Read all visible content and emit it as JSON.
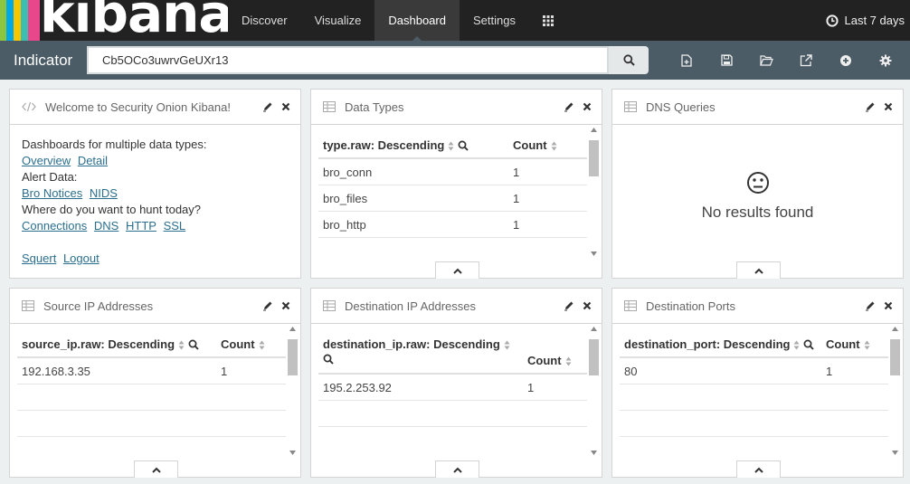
{
  "app": {
    "logo_text": "kibana",
    "brand_colors": [
      "#e8488b",
      "#3cbeb1",
      "#f6c700",
      "#8cc63f",
      "#00a9e5",
      "#ffffff"
    ]
  },
  "nav": {
    "items": [
      "Discover",
      "Visualize",
      "Dashboard",
      "Settings"
    ],
    "active": "Dashboard",
    "apps_icon": "grid-icon",
    "time_label": "Last 7 days"
  },
  "querybar": {
    "title": "Indicator",
    "query": "Cb5OCo3uwrvGeUXr13",
    "tools": [
      "new-dashboard-icon",
      "save-icon",
      "open-icon",
      "share-icon",
      "add-panel-icon",
      "options-icon"
    ]
  },
  "panels": {
    "welcome": {
      "title": "Welcome to Security Onion Kibana!",
      "line1": "Dashboards for multiple data types:",
      "links1": [
        "Overview",
        "Detail"
      ],
      "line2": "Alert Data:",
      "links2": [
        "Bro Notices",
        "NIDS"
      ],
      "line3": "Where do you want to hunt today?",
      "links3": [
        "Connections",
        "DNS",
        "HTTP",
        "SSL"
      ],
      "links4": [
        "Squert",
        "Logout"
      ]
    },
    "data_types": {
      "title": "Data Types",
      "col1": "type.raw: Descending",
      "col2": "Count",
      "rows": [
        [
          "bro_conn",
          "1"
        ],
        [
          "bro_files",
          "1"
        ],
        [
          "bro_http",
          "1"
        ]
      ]
    },
    "dns": {
      "title": "DNS Queries",
      "empty": "No results found"
    },
    "src_ip": {
      "title": "Source IP Addresses",
      "col1": "source_ip.raw: Descending",
      "col2": "Count",
      "rows": [
        [
          "192.168.3.35",
          "1"
        ]
      ]
    },
    "dst_ip": {
      "title": "Destination IP Addresses",
      "col1": "destination_ip.raw: Descending",
      "col2": "Count",
      "rows": [
        [
          "195.2.253.92",
          "1"
        ]
      ]
    },
    "dst_port": {
      "title": "Destination Ports",
      "col1": "destination_port: Descending",
      "col2": "Count",
      "rows": [
        [
          "80",
          "1"
        ]
      ]
    }
  }
}
